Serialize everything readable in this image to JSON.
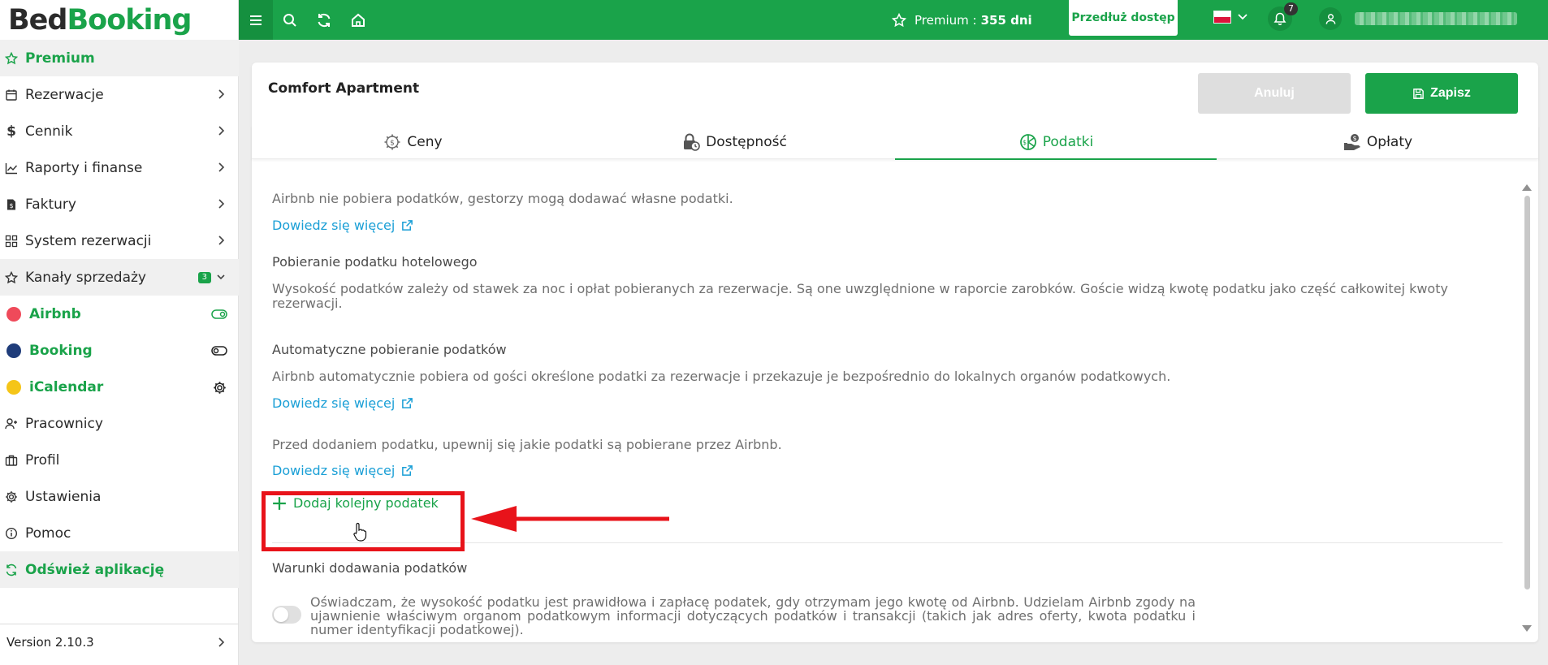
{
  "app": {
    "logo_bed": "Bed",
    "logo_booking": "Booking",
    "brand_color": "#1aa34a"
  },
  "sidebar": {
    "items": [
      {
        "label": "Premium",
        "icon": "star-icon"
      },
      {
        "label": "Rezerwacje",
        "icon": "calendar-icon"
      },
      {
        "label": "Cennik",
        "icon": "dollar-icon"
      },
      {
        "label": "Raporty i finanse",
        "icon": "chart-icon"
      },
      {
        "label": "Faktury",
        "icon": "invoice-icon"
      },
      {
        "label": "System rezerwacji",
        "icon": "grid-icon"
      },
      {
        "label": "Kanały sprzedaży",
        "icon": "star-outline-icon",
        "badge": "3"
      },
      {
        "label": "Pracownicy",
        "icon": "user-add-icon"
      },
      {
        "label": "Profil",
        "icon": "briefcase-icon"
      },
      {
        "label": "Ustawienia",
        "icon": "gear-icon"
      },
      {
        "label": "Pomoc",
        "icon": "info-icon"
      },
      {
        "label": "Odśwież aplikację",
        "icon": "refresh-icon"
      }
    ],
    "channels": [
      {
        "label": "Airbnb",
        "color": "#ef4a5a",
        "status_icon": "toggle-on-icon"
      },
      {
        "label": "Booking",
        "color": "#1f3c7a",
        "status_icon": "toggle-off-icon"
      },
      {
        "label": "iCalendar",
        "color": "#f5c518",
        "status_icon": "gear-icon"
      }
    ],
    "version": "Version 2.10.3"
  },
  "topbar": {
    "premium_label": "Premium : ",
    "premium_days": "355 dni",
    "extend_label": "Przedłuż dostęp",
    "notifications": "7",
    "language": "pl"
  },
  "card": {
    "title": "Comfort Apartment",
    "cancel_label": "Anuluj",
    "save_label": "Zapisz",
    "tabs": [
      {
        "label": "Ceny",
        "icon": "gear-price-icon"
      },
      {
        "label": "Dostępność",
        "icon": "lock-clock-icon"
      },
      {
        "label": "Podatki",
        "icon": "tax-icon",
        "active": true
      },
      {
        "label": "Opłaty",
        "icon": "fee-icon"
      }
    ]
  },
  "content": {
    "intro": "Airbnb nie pobiera podatków, gestorzy mogą dodawać własne podatki.",
    "learn_more": "Dowiedz się więcej",
    "hotel_tax_heading": "Pobieranie podatku hotelowego",
    "hotel_tax_text": "Wysokość podatków zależy od stawek za noc i opłat pobieranych za rezerwacje. Są one uwzględnione w raporcie zarobków. Goście widzą kwotę podatku jako część całkowitej kwoty rezerwacji.",
    "auto_tax_heading": "Automatyczne pobieranie podatków",
    "auto_tax_text": "Airbnb automatycznie pobiera od gości określone podatki za rezerwacje i przekazuje je bezpośrednio do lokalnych organów podatkowych.",
    "before_add_text": "Przed dodaniem podatku, upewnij się jakie podatki są pobierane przez Airbnb.",
    "add_tax_label": "Dodaj kolejny podatek",
    "conditions_heading": "Warunki dodawania podatków",
    "consent_text": "Oświadczam, że wysokość podatku jest prawidłowa i zapłacę podatek, gdy otrzymam jego kwotę od Airbnb. Udzielam Airbnb zgody na ujawnienie właściwym organom podatkowym informacji dotyczących podatków i transakcji (takich jak adres oferty, kwota podatku i numer identyfikacji podatkowej).",
    "consent_checked": false
  }
}
